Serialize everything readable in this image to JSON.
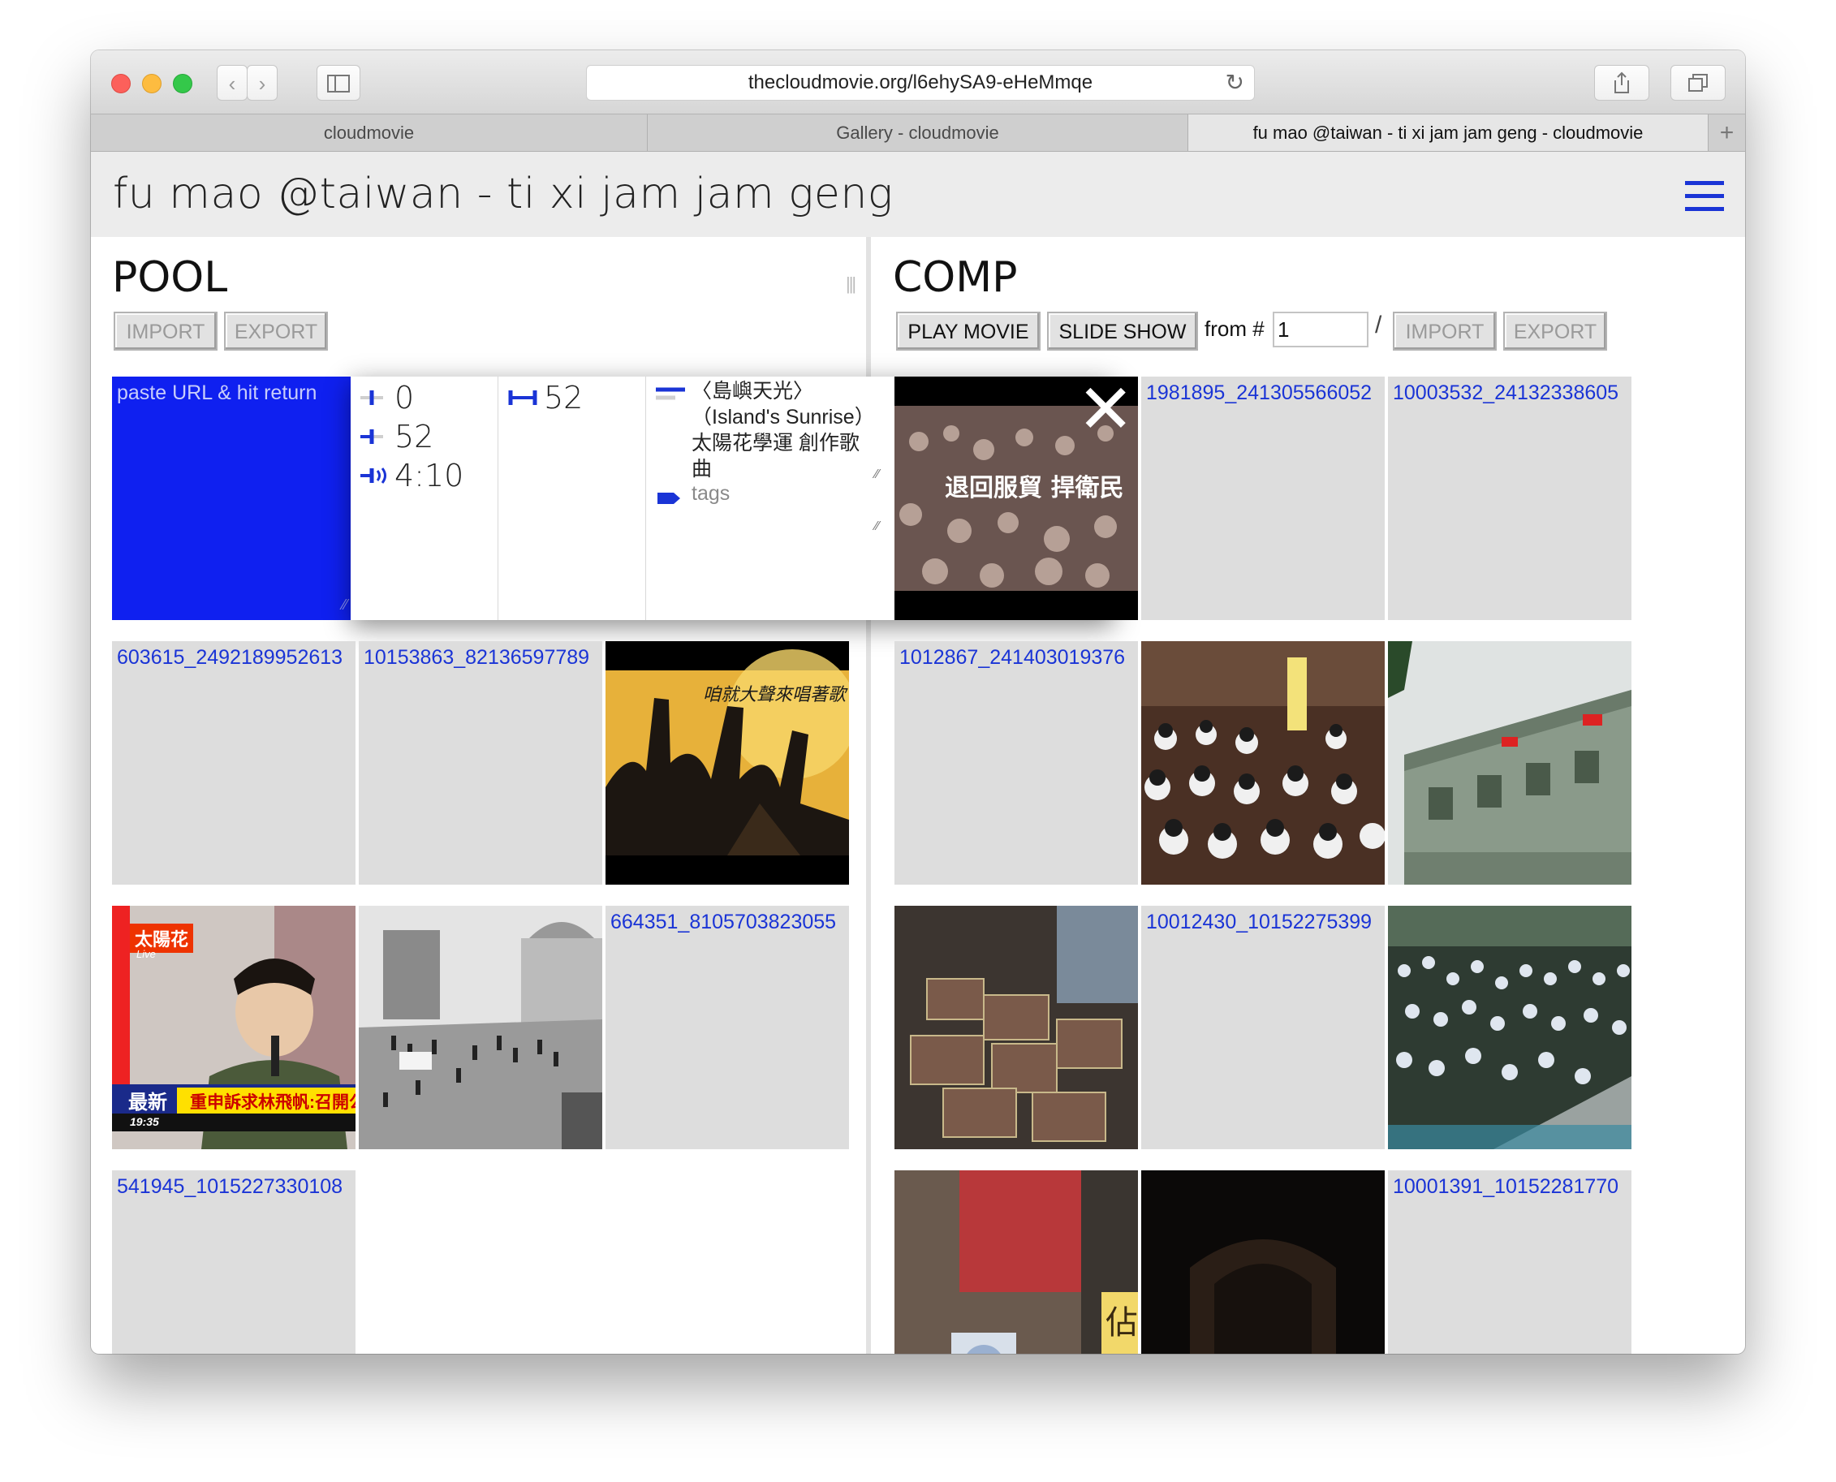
{
  "browser": {
    "url": "thecloudmovie.org/l6ehySA9-eHeMmqe",
    "tabs": [
      "cloudmovie",
      "Gallery - cloudmovie",
      "fu mao @taiwan - ti xi jam jam geng - cloudmovie"
    ],
    "new_tab": "+"
  },
  "app": {
    "title": "fu mao @taiwan - ti xi jam jam geng"
  },
  "pool": {
    "title": "POOL",
    "import_label": "IMPORT",
    "export_label": "EXPORT",
    "paste_placeholder": "paste URL & hit return",
    "editor": {
      "start": "0",
      "end": "52",
      "duration": "4:10",
      "length": "52",
      "caption": "〈島嶼天光〉（Island's Sunrise） 太陽花學運 創作歌曲",
      "tags_placeholder": "tags"
    },
    "cards": [
      "603615_2492189952613",
      "10153863_82136597789",
      "664351_8105703823055",
      "541945_1015227330108"
    ]
  },
  "comp": {
    "title": "COMP",
    "play_label": "PLAY MOVIE",
    "slideshow_label": "SLIDE SHOW",
    "from_label": "from #",
    "from_value": "1",
    "slash": "/",
    "import_label": "IMPORT",
    "export_label": "EXPORT",
    "close_glyph": "✕",
    "thumb_text": "退回服貿 捍衛民",
    "cards": [
      "1981895_241305566052",
      "10003532_24132338605",
      "1012867_241403019376",
      "10012430_10152275399",
      "10001391_10152281770"
    ]
  },
  "news_overlay": {
    "badge": "太陽花",
    "headline": "重申訴求林飛帆:召開公民",
    "tag": "最新",
    "time": "19:35",
    "live": "Live"
  },
  "poster_text": "咱就大聲來唱著歌",
  "sign_text": "佔"
}
